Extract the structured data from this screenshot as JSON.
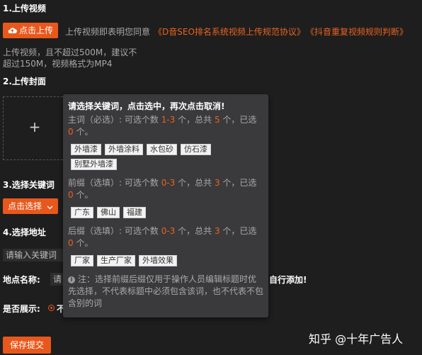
{
  "upload_video": {
    "title": "1.上传视频",
    "button_label": "点击上传",
    "agree_text": "上传视频即表明您同意",
    "link1": "《D音SEO排名系统视频上传规范协议》",
    "link2": "《抖音重复视频规则判断》",
    "hint_line1": "上传视频，且不超过500M，建议不",
    "hint_line2": "超过150M，视频格式为MP4"
  },
  "upload_cover": {
    "title": "2.上传封面",
    "plus": "+"
  },
  "keywords": {
    "title": "3.选择关键词",
    "button_label": "点击选择",
    "chevron": "⌄"
  },
  "address": {
    "title": "4.选择地址",
    "input_value": "请输入关键词"
  },
  "location": {
    "label": "地点名称:",
    "input_fragment": "请",
    "trailing_text": "自行添加!"
  },
  "show": {
    "label": "是否展示:",
    "radio_fragment": "不"
  },
  "submit_label": "保存提交",
  "popup": {
    "heading": "请选择关键词，点击选中，再次点击取消!",
    "main": {
      "line1_a": "主词（必选）: 可选个数 ",
      "line1_range": "1-3",
      "line1_b": " 个，总共 ",
      "line1_total": "5",
      "line1_c": " 个，已选",
      "line2_count": "0",
      "line2_suffix": " 个。",
      "tags": [
        "外墙漆",
        "外墙涂料",
        "水包砂",
        "仿石漆",
        "别墅外墙漆"
      ]
    },
    "prefix": {
      "line1_a": "前缀（选填）: 可选个数 ",
      "line1_range": "0-3",
      "line1_b": " 个，总共 ",
      "line1_total": "3",
      "line1_c": " 个，已选",
      "line2_count": "0",
      "line2_suffix": " 个。",
      "tags": [
        "广东",
        "佛山",
        "福建"
      ]
    },
    "suffix": {
      "line1_a": "后缀（选填）: 可选个数 ",
      "line1_range": "0-3",
      "line1_b": " 个，总共 ",
      "line1_total": "3",
      "line1_c": " 个，已选",
      "line2_count": "0",
      "line2_suffix": " 个。",
      "tags": [
        "厂家",
        "生产厂家",
        "外墙效果"
      ]
    },
    "note_line1": "注：选择前缀后缀仅用于操作人员编辑标题时优",
    "note_line2": "先选择，不代表标题中必须包含该词，也不代表不包",
    "note_line3": "含别的词"
  },
  "watermark": "知乎 @十年广告人",
  "colors": {
    "accent": "#e8581c",
    "background": "#1e1e1e",
    "popup": "#3a3a3c"
  },
  "icons": {
    "upload": "cloud-upload-icon",
    "info": "info-icon",
    "chevron": "chevron-down-icon"
  }
}
